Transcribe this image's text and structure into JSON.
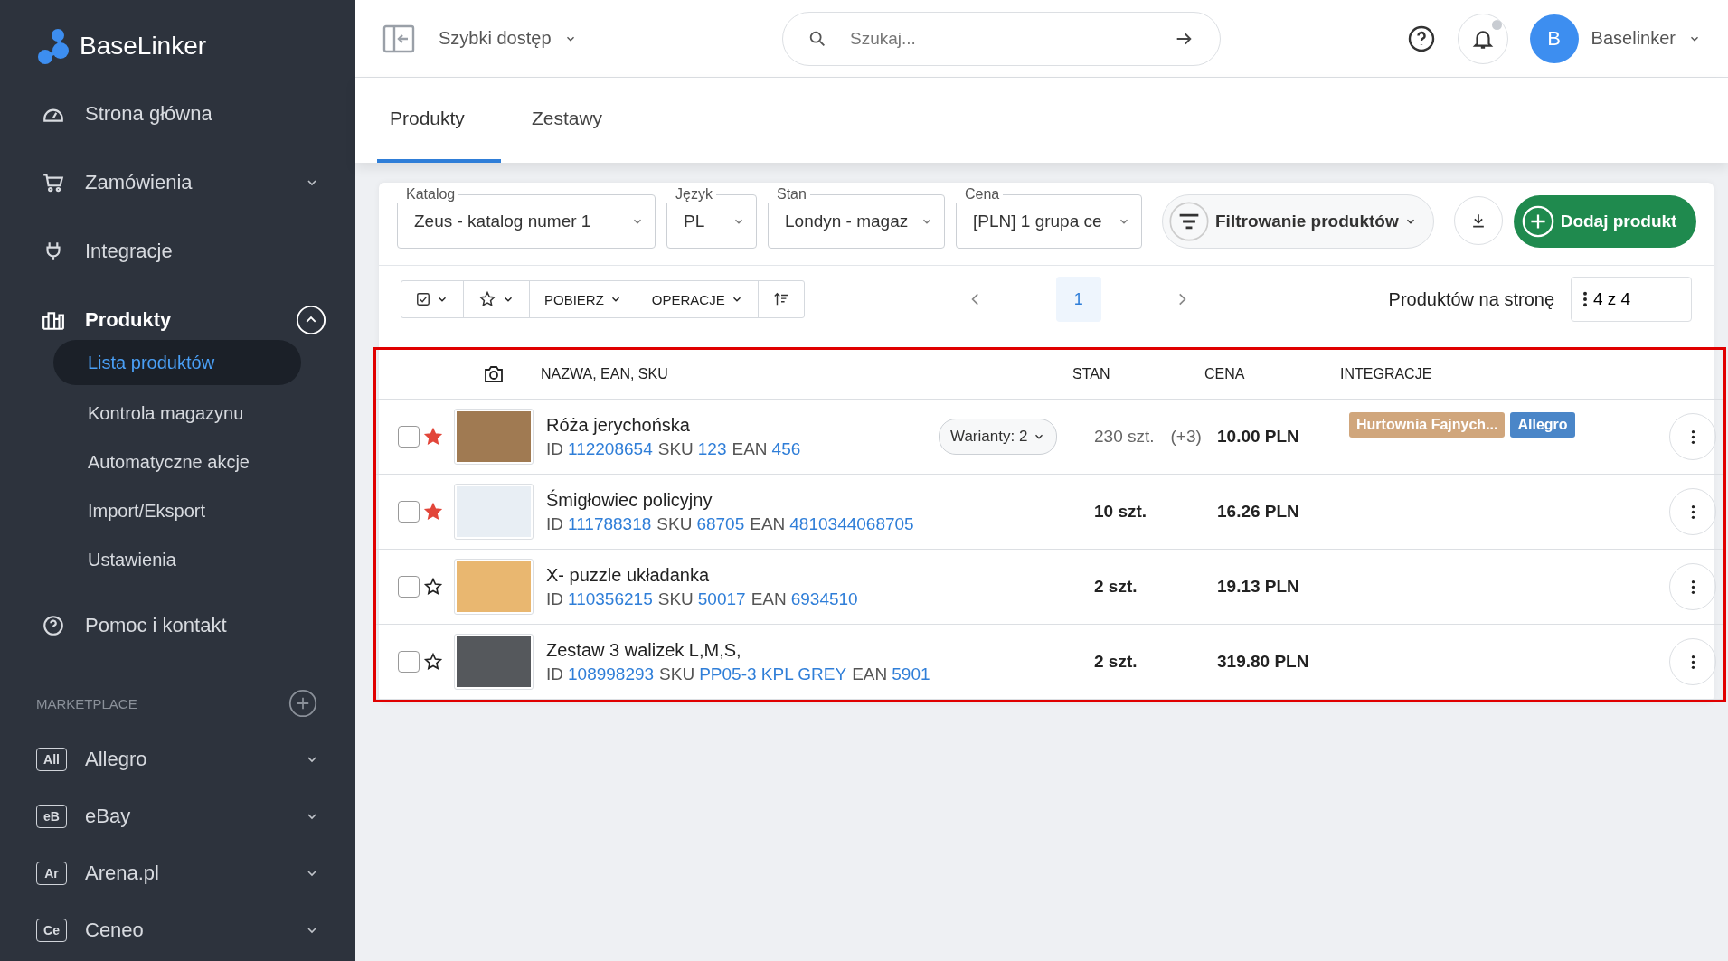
{
  "sidebar": {
    "logo": "BaseLinker",
    "items": [
      {
        "label": "Strona główna",
        "selected": false
      },
      {
        "label": "Zamówienia",
        "selected": false,
        "expanded": false
      },
      {
        "label": "Integracje",
        "selected": false
      },
      {
        "label": "Produkty",
        "selected": true,
        "expanded": true,
        "children": [
          {
            "label": "Lista produktów",
            "selected": true
          },
          {
            "label": "Kontrola magazynu",
            "selected": false
          },
          {
            "label": "Automatyczne akcje",
            "selected": false
          },
          {
            "label": "Import/Eksport",
            "selected": false
          },
          {
            "label": "Ustawienia",
            "selected": false
          }
        ]
      },
      {
        "label": "Pomoc i kontakt",
        "selected": false
      }
    ],
    "marketplace": {
      "title": "MARKETPLACE",
      "items": [
        {
          "badge": "All",
          "label": "Allegro",
          "expanded": false
        },
        {
          "badge": "eB",
          "label": "eBay",
          "expanded": false
        },
        {
          "badge": "Ar",
          "label": "Arena.pl",
          "expanded": false
        },
        {
          "badge": "Ce",
          "label": "Ceneo",
          "expanded": false
        }
      ]
    }
  },
  "header": {
    "quick_access": "Szybki dostęp",
    "search": {
      "placeholder": "Szukaj..."
    },
    "notifications_unread": true,
    "avatar": "B",
    "user": "Baselinker"
  },
  "tabs": [
    {
      "label": "Produkty",
      "selected": true
    },
    {
      "label": "Zestawy",
      "selected": false
    }
  ],
  "filters": [
    {
      "label": "Katalog",
      "value": "Zeus - katalog numer 1"
    },
    {
      "label": "Język",
      "value": "PL"
    },
    {
      "label": "Stan",
      "value": "Londyn - magaz"
    },
    {
      "label": "Cena",
      "value": "[PLN] 1 grupa ce"
    }
  ],
  "filter_button": "Filtrowanie produktów",
  "add_button": "Dodaj produkt",
  "toolbar": {
    "download": "POBIERZ",
    "operations": "OPERACJE"
  },
  "pagination": {
    "pages": [
      {
        "label": "1",
        "selected": true
      }
    ]
  },
  "per_page": {
    "label": "Produktów na stronę",
    "value": "4 z 4"
  },
  "table": {
    "highlighted": true,
    "columns": [
      "NAZWA, EAN, SKU",
      "STAN",
      "CENA",
      "INTEGRACJE"
    ],
    "rows": [
      {
        "checked": false,
        "starred": true,
        "name": "Róża jerychońska",
        "codes": [
          {
            "label": "ID",
            "value": "112208654"
          },
          {
            "label": "SKU",
            "value": "123"
          },
          {
            "label": "EAN",
            "value": "456"
          }
        ],
        "variants": "Warianty: 2",
        "stock": "230 szt.",
        "stock_extra": "(+3)",
        "price": "10.00 PLN",
        "tags": [
          {
            "label": "Hurtownia Fajnych...",
            "color": "#d0a67c"
          },
          {
            "label": "Allegro",
            "color": "#4a86c8"
          }
        ]
      },
      {
        "checked": false,
        "starred": true,
        "name": "Śmigłowiec policyjny",
        "codes": [
          {
            "label": "ID",
            "value": "111788318"
          },
          {
            "label": "SKU",
            "value": "68705"
          },
          {
            "label": "EAN",
            "value": "4810344068705"
          }
        ],
        "stock": "10 szt.",
        "price": "16.26 PLN",
        "tags": []
      },
      {
        "checked": false,
        "starred": false,
        "name": "X- puzzle układanka",
        "codes": [
          {
            "label": "ID",
            "value": "110356215"
          },
          {
            "label": "SKU",
            "value": "50017"
          },
          {
            "label": "EAN",
            "value": "6934510"
          }
        ],
        "stock": "2 szt.",
        "price": "19.13 PLN",
        "tags": []
      },
      {
        "checked": false,
        "starred": false,
        "name": "Zestaw 3 walizek L,M,S,",
        "codes": [
          {
            "label": "ID",
            "value": "108998293"
          },
          {
            "label": "SKU",
            "value": "PP05-3 KPL GREY"
          },
          {
            "label": "EAN",
            "value": "5901"
          }
        ],
        "stock": "2 szt.",
        "price": "319.80 PLN",
        "tags": []
      }
    ]
  }
}
